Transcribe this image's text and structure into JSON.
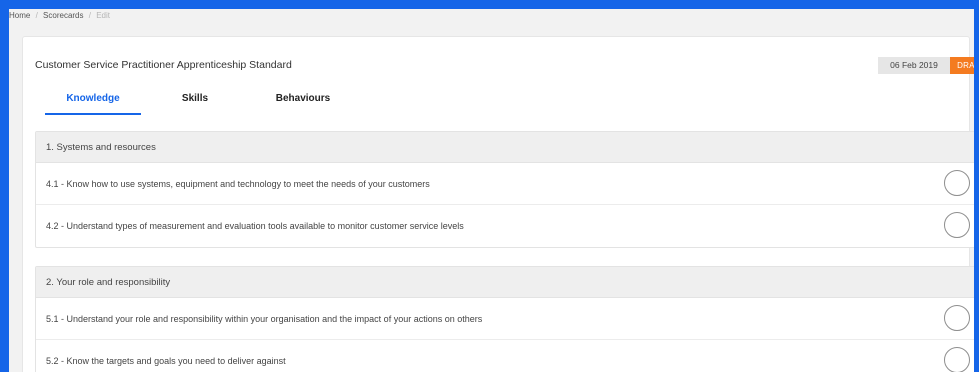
{
  "breadcrumb": {
    "home": "Home",
    "scorecards": "Scorecards",
    "current": "Edit",
    "separator": "/"
  },
  "header": {
    "title": "Customer Service Practitioner Apprenticeship Standard",
    "date": "06 Feb 2019",
    "status": "DRAFT"
  },
  "tabs": [
    {
      "label": "Knowledge",
      "active": true
    },
    {
      "label": "Skills",
      "active": false
    },
    {
      "label": "Behaviours",
      "active": false
    }
  ],
  "sections": [
    {
      "title": "1. Systems and resources",
      "items": [
        {
          "label": "4.1 - Know how to use systems, equipment and technology to meet the needs of your customers",
          "checked": false
        },
        {
          "label": "4.2 - Understand types of measurement and evaluation tools available to monitor customer service levels",
          "checked": false
        }
      ]
    },
    {
      "title": "2. Your role and responsibility",
      "items": [
        {
          "label": "5.1 - Understand your role and responsibility within your organisation and the impact of your actions on others",
          "checked": false
        },
        {
          "label": "5.2 - Know the targets and goals you need to deliver against",
          "checked": false
        }
      ]
    }
  ],
  "colors": {
    "accent": "#1565e8",
    "draft": "#f47b20"
  },
  "icons": {
    "item_check": "empty-circle-icon"
  }
}
